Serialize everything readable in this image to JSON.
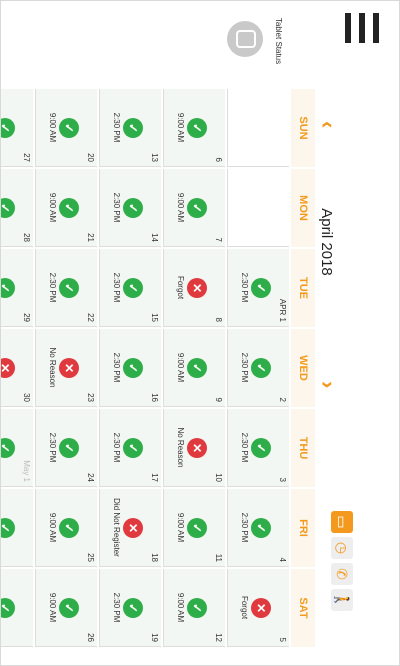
{
  "header": {
    "menu_icon": "hamburger-icon",
    "title": "April 2018",
    "prev_icon": "chevron-left",
    "next_icon": "chevron-right",
    "tools": [
      {
        "name": "tablet-tool",
        "glyph": "▭",
        "active": true
      },
      {
        "name": "clock-tool",
        "glyph": "◷",
        "active": false
      },
      {
        "name": "phone-tool",
        "glyph": "✆",
        "active": false
      },
      {
        "name": "person-tool",
        "glyph": "🚶",
        "active": false
      }
    ]
  },
  "weekdays": [
    "SUN",
    "MON",
    "TUE",
    "WED",
    "THU",
    "FRI",
    "SAT"
  ],
  "tablet_status": {
    "label": "Tablet Status"
  },
  "colors": {
    "accent": "#f39a1e",
    "ok": "#2eae49",
    "bad": "#e0393e"
  },
  "weeks": [
    [
      {
        "day": "",
        "blank": true
      },
      {
        "day": "",
        "blank": true
      },
      {
        "day": "APR 1",
        "status": "ok",
        "text": "2:30 PM"
      },
      {
        "day": "2",
        "status": "ok",
        "text": "2:30 PM"
      },
      {
        "day": "3",
        "status": "ok",
        "text": "2:30 PM"
      },
      {
        "day": "4",
        "status": "ok",
        "text": "2:30 PM"
      },
      {
        "day": "5",
        "status": "bad",
        "text": "Forgot"
      }
    ],
    [
      {
        "day": "6",
        "status": "ok",
        "text": "9:00 AM"
      },
      {
        "day": "7",
        "status": "ok",
        "text": "9:00 AM"
      },
      {
        "day": "8",
        "status": "bad",
        "text": "Forgot"
      },
      {
        "day": "9",
        "status": "ok",
        "text": "9:00 AM"
      },
      {
        "day": "10",
        "status": "bad",
        "text": "No Reason"
      },
      {
        "day": "11",
        "status": "ok",
        "text": "9:00 AM"
      },
      {
        "day": "12",
        "status": "ok",
        "text": "9:00 AM"
      }
    ],
    [
      {
        "day": "13",
        "status": "ok",
        "text": "2:30 PM"
      },
      {
        "day": "14",
        "status": "ok",
        "text": "2:30 PM"
      },
      {
        "day": "15",
        "status": "ok",
        "text": "2:30 PM"
      },
      {
        "day": "16",
        "status": "ok",
        "text": "2:30 PM"
      },
      {
        "day": "17",
        "status": "ok",
        "text": "2:30 PM"
      },
      {
        "day": "18",
        "status": "bad",
        "text": "Did Not Register"
      },
      {
        "day": "19",
        "status": "ok",
        "text": "2:30 PM"
      }
    ],
    [
      {
        "day": "20",
        "status": "ok",
        "text": "9:00 AM"
      },
      {
        "day": "21",
        "status": "ok",
        "text": "9:00 AM"
      },
      {
        "day": "22",
        "status": "ok",
        "text": "2:30 PM"
      },
      {
        "day": "23",
        "status": "bad",
        "text": "No Reason"
      },
      {
        "day": "24",
        "status": "ok",
        "text": "2:30 PM"
      },
      {
        "day": "25",
        "status": "ok",
        "text": "9:00 AM"
      },
      {
        "day": "26",
        "status": "ok",
        "text": "9:00 AM"
      }
    ],
    [
      {
        "day": "27",
        "status": "ok",
        "text": ""
      },
      {
        "day": "28",
        "status": "ok",
        "text": ""
      },
      {
        "day": "29",
        "status": "ok",
        "text": ""
      },
      {
        "day": "30",
        "status": "bad",
        "text": ""
      },
      {
        "day": "May 1",
        "status": "ok",
        "text": "",
        "dim": true
      },
      {
        "day": "",
        "status": "ok",
        "text": ""
      },
      {
        "day": "",
        "status": "ok",
        "text": ""
      }
    ]
  ]
}
